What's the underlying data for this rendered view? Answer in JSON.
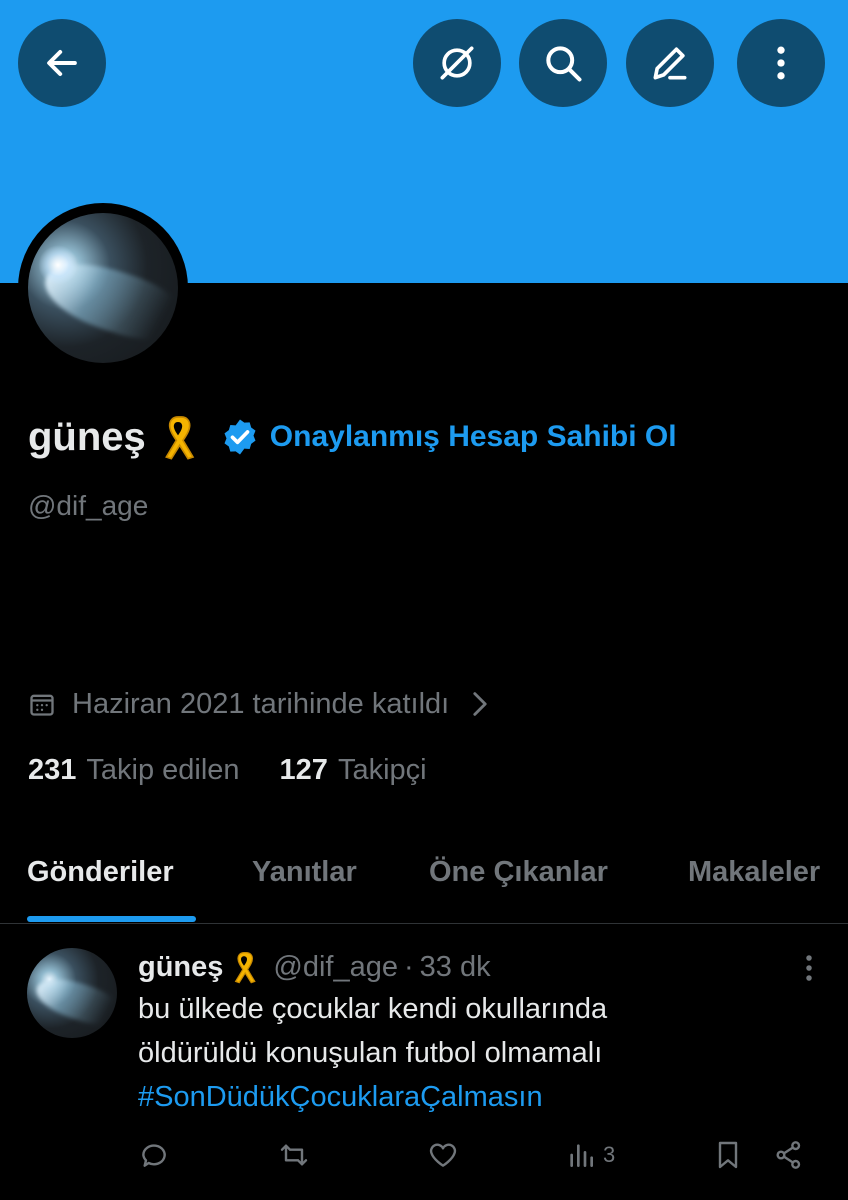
{
  "header": {
    "back_icon": "arrow-left-icon",
    "grok_icon": "grok-icon",
    "search_icon": "search-icon",
    "edit_icon": "pencil-icon",
    "more_icon": "more-vertical-icon",
    "banner_color": "#1d9bf0"
  },
  "profile": {
    "display_name": "güneş",
    "ribbon_icon": "yellow-ribbon-icon",
    "verified_icon": "verified-badge-icon",
    "verify_cta": "Onaylanmış Hesap Sahibi Ol",
    "handle": "@dif_age",
    "joined": "Haziran 2021 tarihinde katıldı",
    "following_count": "231",
    "following_label": "Takip edilen",
    "followers_count": "127",
    "followers_label": "Takipçi"
  },
  "tabs": [
    {
      "label": "Gönderiler",
      "active": true
    },
    {
      "label": "Yanıtlar",
      "active": false
    },
    {
      "label": "Öne Çıkanlar",
      "active": false
    },
    {
      "label": "Makaleler",
      "active": false
    }
  ],
  "post": {
    "name": "güneş",
    "handle": "@dif_age",
    "dot": "·",
    "time": "33 dk",
    "line1": "bu ülkede çocuklar kendi okullarında",
    "line2": "öldürüldü konuşulan futbol olmamalı",
    "hashtag": "#SonDüdükÇocuklaraÇalmasın",
    "views_count": "3"
  },
  "colors": {
    "accent": "#1d9bf0",
    "muted": "#71767b",
    "text": "#e7e9ea",
    "background": "#000000"
  }
}
